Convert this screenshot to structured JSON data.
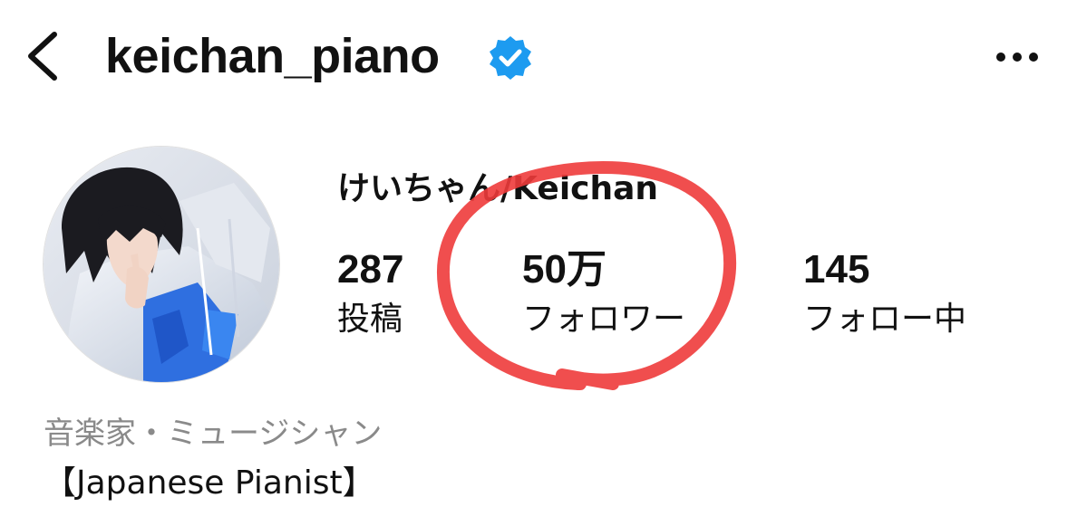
{
  "header": {
    "back_icon": "chevron-left-icon",
    "username": "keichan_piano",
    "verified_icon": "verified-badge-icon",
    "more_icon": "more-horizontal-icon"
  },
  "profile": {
    "display_name": "けいちゃん/Keichan",
    "stats": {
      "posts": {
        "value": "287",
        "label": "投稿"
      },
      "followers": {
        "value": "50万",
        "label": "フォロワー"
      },
      "following": {
        "value": "145",
        "label": "フォロー中"
      }
    },
    "category": "音楽家・ミュージシャン",
    "bio": "【Japanese Pianist】"
  },
  "colors": {
    "verified_blue": "#1d9bf0",
    "annotation_red": "#ee3b3b",
    "category_gray": "#8a8a8a",
    "text": "#111111"
  }
}
